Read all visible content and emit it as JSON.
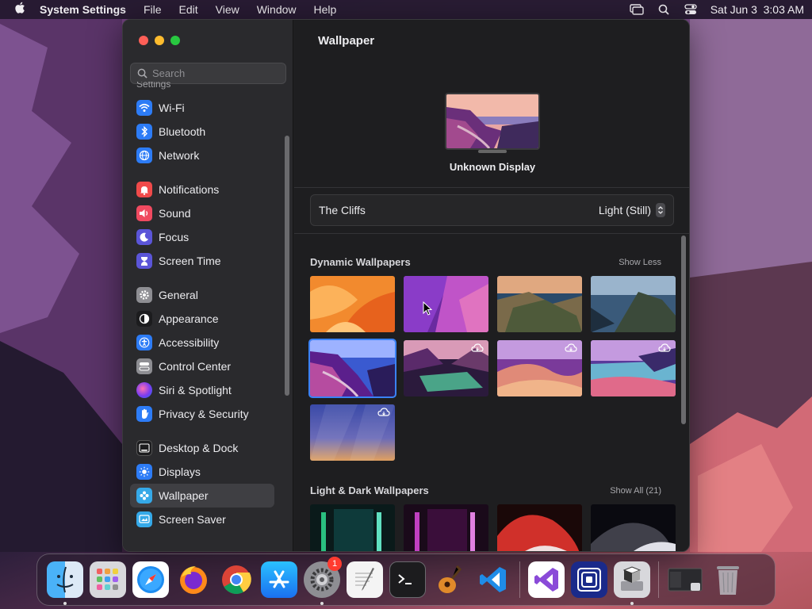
{
  "menubar": {
    "app_name": "System Settings",
    "items": [
      "File",
      "Edit",
      "View",
      "Window",
      "Help"
    ],
    "clock": "Sat Jun 3  3:03 AM"
  },
  "window": {
    "search": {
      "placeholder": "Search"
    },
    "sidebar": {
      "cut_label": "Settings",
      "groups": [
        [
          {
            "label": "Wi-Fi",
            "icon": "wifi-icon",
            "color": "#2d7cf6"
          },
          {
            "label": "Bluetooth",
            "icon": "bluetooth-icon",
            "color": "#2d7cf6"
          },
          {
            "label": "Network",
            "icon": "globe-icon",
            "color": "#2d7cf6"
          }
        ],
        [
          {
            "label": "Notifications",
            "icon": "bell-icon",
            "color": "#f04a4a"
          },
          {
            "label": "Sound",
            "icon": "speaker-icon",
            "color": "#f04a60"
          },
          {
            "label": "Focus",
            "icon": "moon-icon",
            "color": "#5b55d8"
          },
          {
            "label": "Screen Time",
            "icon": "hourglass-icon",
            "color": "#5b55d8"
          }
        ],
        [
          {
            "label": "General",
            "icon": "gear-icon",
            "color": "#8e8e93"
          },
          {
            "label": "Appearance",
            "icon": "appearance-icon",
            "color": "#1c1c1e"
          },
          {
            "label": "Accessibility",
            "icon": "accessibility-icon",
            "color": "#2d7cf6"
          },
          {
            "label": "Control Center",
            "icon": "control-center-icon",
            "color": "#8e8e93"
          },
          {
            "label": "Siri & Spotlight",
            "icon": "siri-icon",
            "color": "#a34fd8"
          },
          {
            "label": "Privacy & Security",
            "icon": "hand-icon",
            "color": "#2d7cf6"
          }
        ],
        [
          {
            "label": "Desktop & Dock",
            "icon": "dock-icon",
            "color": "#1c1c1e"
          },
          {
            "label": "Displays",
            "icon": "sun-icon",
            "color": "#2d7cf6"
          },
          {
            "label": "Wallpaper",
            "icon": "wallpaper-icon",
            "color": "#35a9e8",
            "selected": true
          },
          {
            "label": "Screen Saver",
            "icon": "screensaver-icon",
            "color": "#35a9e8"
          }
        ]
      ]
    },
    "main": {
      "title": "Wallpaper",
      "display_name": "Unknown Display",
      "current_wallpaper": "The Cliffs",
      "style_value": "Light (Still)",
      "sections": [
        {
          "title": "Dynamic Wallpapers",
          "link": "Show Less"
        },
        {
          "title": "Light & Dark Wallpapers",
          "link": "Show All (21)"
        }
      ]
    }
  },
  "dock": {
    "settings_badge": "1"
  }
}
